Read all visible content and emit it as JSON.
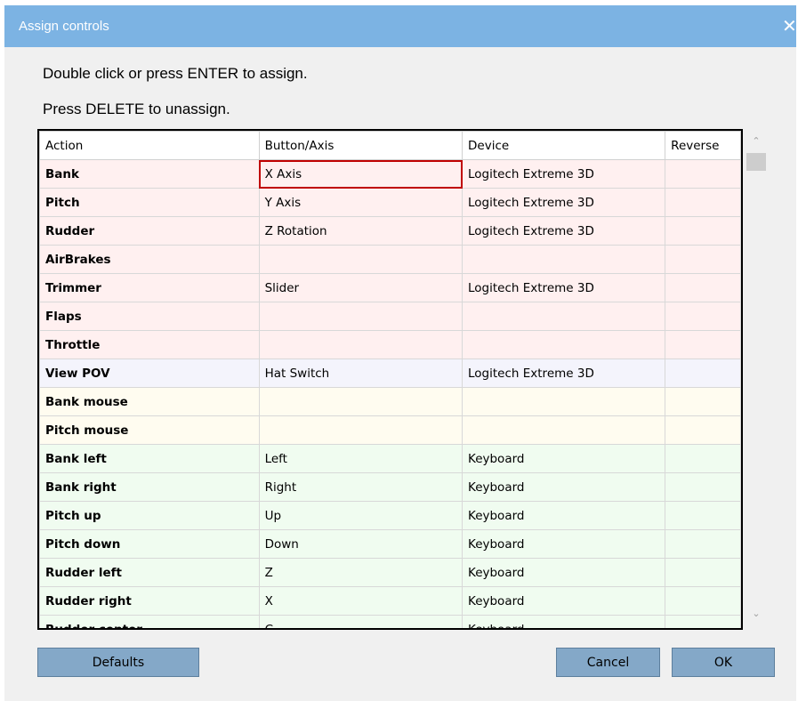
{
  "window": {
    "title": "Assign controls",
    "close_glyph": "✕"
  },
  "instructions": [
    "Double click or press ENTER to assign.",
    "Press DELETE to unassign."
  ],
  "table": {
    "columns": [
      "Action",
      "Button/Axis",
      "Device",
      "Reverse"
    ],
    "selected": {
      "row": 0,
      "column": 1
    },
    "rows": [
      {
        "action": "Bank",
        "button": "X Axis",
        "device": "Logitech Extreme 3D",
        "reverse": "",
        "group_color": "#fff0f0"
      },
      {
        "action": "Pitch",
        "button": "Y Axis",
        "device": "Logitech Extreme 3D",
        "reverse": "",
        "group_color": "#fff0f0"
      },
      {
        "action": "Rudder",
        "button": "Z Rotation",
        "device": "Logitech Extreme 3D",
        "reverse": "",
        "group_color": "#fff0f0"
      },
      {
        "action": "AirBrakes",
        "button": "",
        "device": "",
        "reverse": "",
        "group_color": "#fff0f0"
      },
      {
        "action": "Trimmer",
        "button": "Slider",
        "device": "Logitech Extreme 3D",
        "reverse": "",
        "group_color": "#fff0f0"
      },
      {
        "action": "Flaps",
        "button": "",
        "device": "",
        "reverse": "",
        "group_color": "#fff0f0"
      },
      {
        "action": "Throttle",
        "button": "",
        "device": "",
        "reverse": "",
        "group_color": "#fff0f0"
      },
      {
        "action": "View POV",
        "button": "Hat Switch",
        "device": "Logitech Extreme 3D",
        "reverse": "",
        "group_color": "#f4f4fc"
      },
      {
        "action": "Bank mouse",
        "button": "",
        "device": "",
        "reverse": "",
        "group_color": "#fffcf0"
      },
      {
        "action": "Pitch mouse",
        "button": "",
        "device": "",
        "reverse": "",
        "group_color": "#fffcf0"
      },
      {
        "action": "Bank left",
        "button": "Left",
        "device": "Keyboard",
        "reverse": "",
        "group_color": "#f0fcf0"
      },
      {
        "action": "Bank right",
        "button": "Right",
        "device": "Keyboard",
        "reverse": "",
        "group_color": "#f0fcf0"
      },
      {
        "action": "Pitch up",
        "button": "Up",
        "device": "Keyboard",
        "reverse": "",
        "group_color": "#f0fcf0"
      },
      {
        "action": "Pitch down",
        "button": "Down",
        "device": "Keyboard",
        "reverse": "",
        "group_color": "#f0fcf0"
      },
      {
        "action": "Rudder left",
        "button": "Z",
        "device": "Keyboard",
        "reverse": "",
        "group_color": "#f0fcf0"
      },
      {
        "action": "Rudder right",
        "button": "X",
        "device": "Keyboard",
        "reverse": "",
        "group_color": "#f0fcf0"
      },
      {
        "action": "Rudder center",
        "button": "C",
        "device": "Keyboard",
        "reverse": "",
        "group_color": "#f0fcf0"
      }
    ]
  },
  "scrollbar": {
    "up_glyph": "⌃",
    "down_glyph": "⌄"
  },
  "buttons": {
    "defaults": "Defaults",
    "cancel": "Cancel",
    "ok": "OK"
  }
}
